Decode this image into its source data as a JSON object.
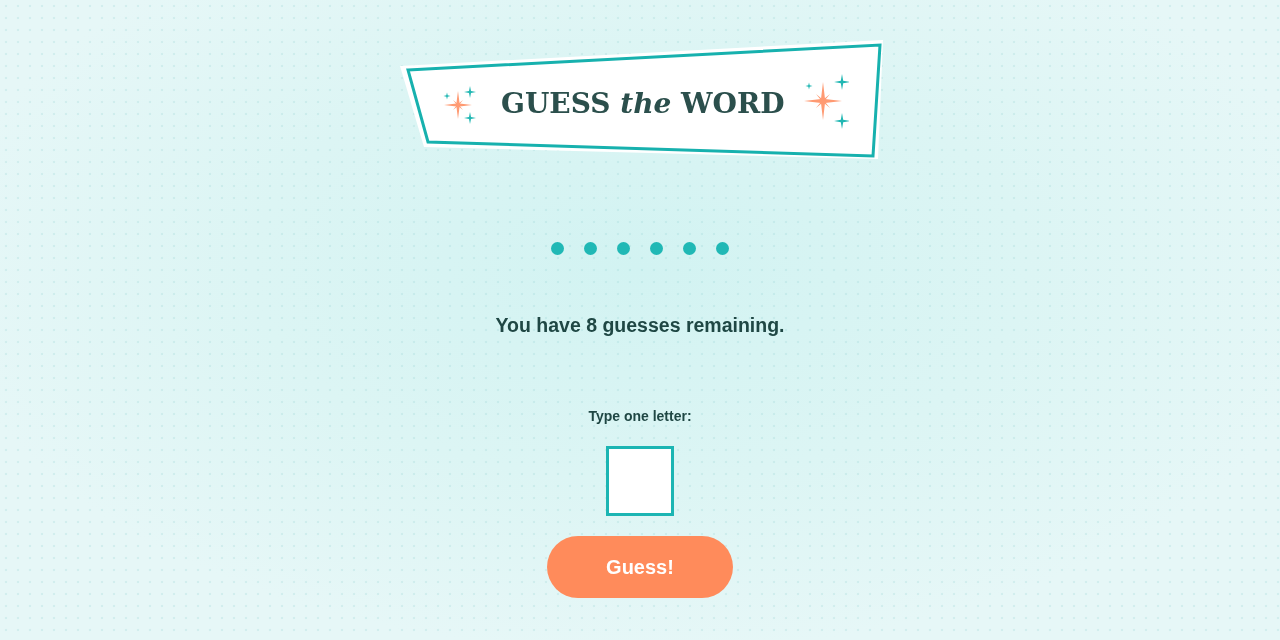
{
  "logo": {
    "title": "GUESS *the* WORD"
  },
  "word": {
    "letters": [
      {
        "kind": "hidden"
      },
      {
        "kind": "hidden"
      },
      {
        "kind": "hidden"
      },
      {
        "kind": "hidden"
      },
      {
        "kind": "hidden"
      },
      {
        "kind": "hidden"
      }
    ]
  },
  "status": {
    "message": "You have 8 guesses remaining."
  },
  "guess_form": {
    "label": "Type one letter:",
    "button": "Guess!"
  }
}
